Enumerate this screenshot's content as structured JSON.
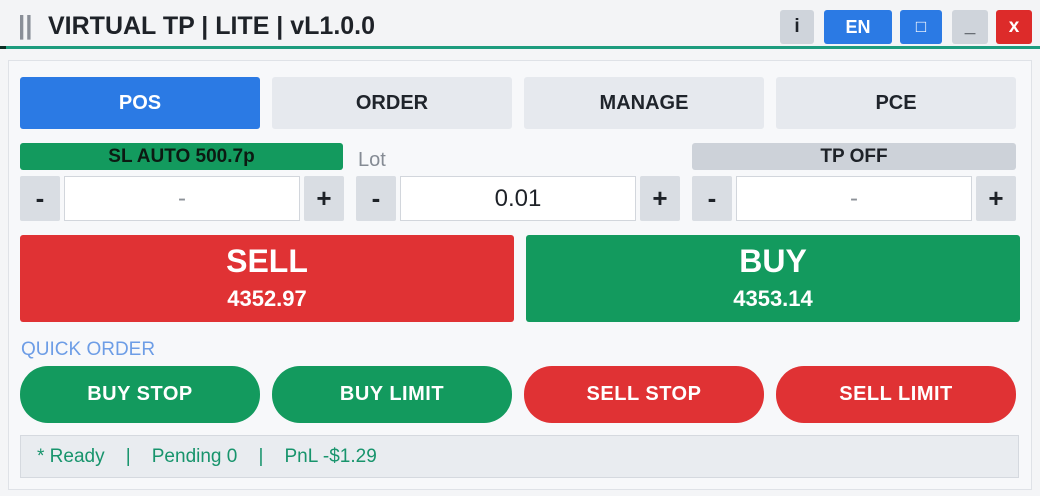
{
  "window": {
    "grip": "||",
    "title": "VIRTUAL TP | LITE | vL1.0.0",
    "buttons": {
      "info": "i",
      "lang": "EN",
      "maximize": "□",
      "minimize": "_",
      "close": "x"
    }
  },
  "tabs": [
    {
      "label": "POS",
      "active": true
    },
    {
      "label": "ORDER",
      "active": false
    },
    {
      "label": "MANAGE",
      "active": false
    },
    {
      "label": "PCE",
      "active": false
    }
  ],
  "sl": {
    "label": "SL AUTO 500.7p",
    "minus": "-",
    "value": "-",
    "plus": "+"
  },
  "lot": {
    "label": "Lot",
    "minus": "-",
    "value": "0.01",
    "plus": "+"
  },
  "tp": {
    "label": "TP  OFF",
    "minus": "-",
    "value": "-",
    "plus": "+"
  },
  "sell": {
    "label": "SELL",
    "price": "4352.97"
  },
  "buy": {
    "label": "BUY",
    "price": "4353.14"
  },
  "quick_order": {
    "label": "QUICK ORDER",
    "buttons": [
      "BUY STOP",
      "BUY LIMIT",
      "SELL STOP",
      "SELL LIMIT"
    ]
  },
  "status": {
    "text": "* Ready    |    Pending 0    |    PnL -$1.29"
  },
  "colors": {
    "accent_blue": "#2b7ae4",
    "buy_green": "#139a5e",
    "sell_red": "#e03234",
    "close_red": "#dd2b2a",
    "status_green": "#17946c"
  },
  "icons": [
    "grip-icon",
    "info-icon",
    "maximize-icon",
    "minimize-icon",
    "close-icon"
  ]
}
